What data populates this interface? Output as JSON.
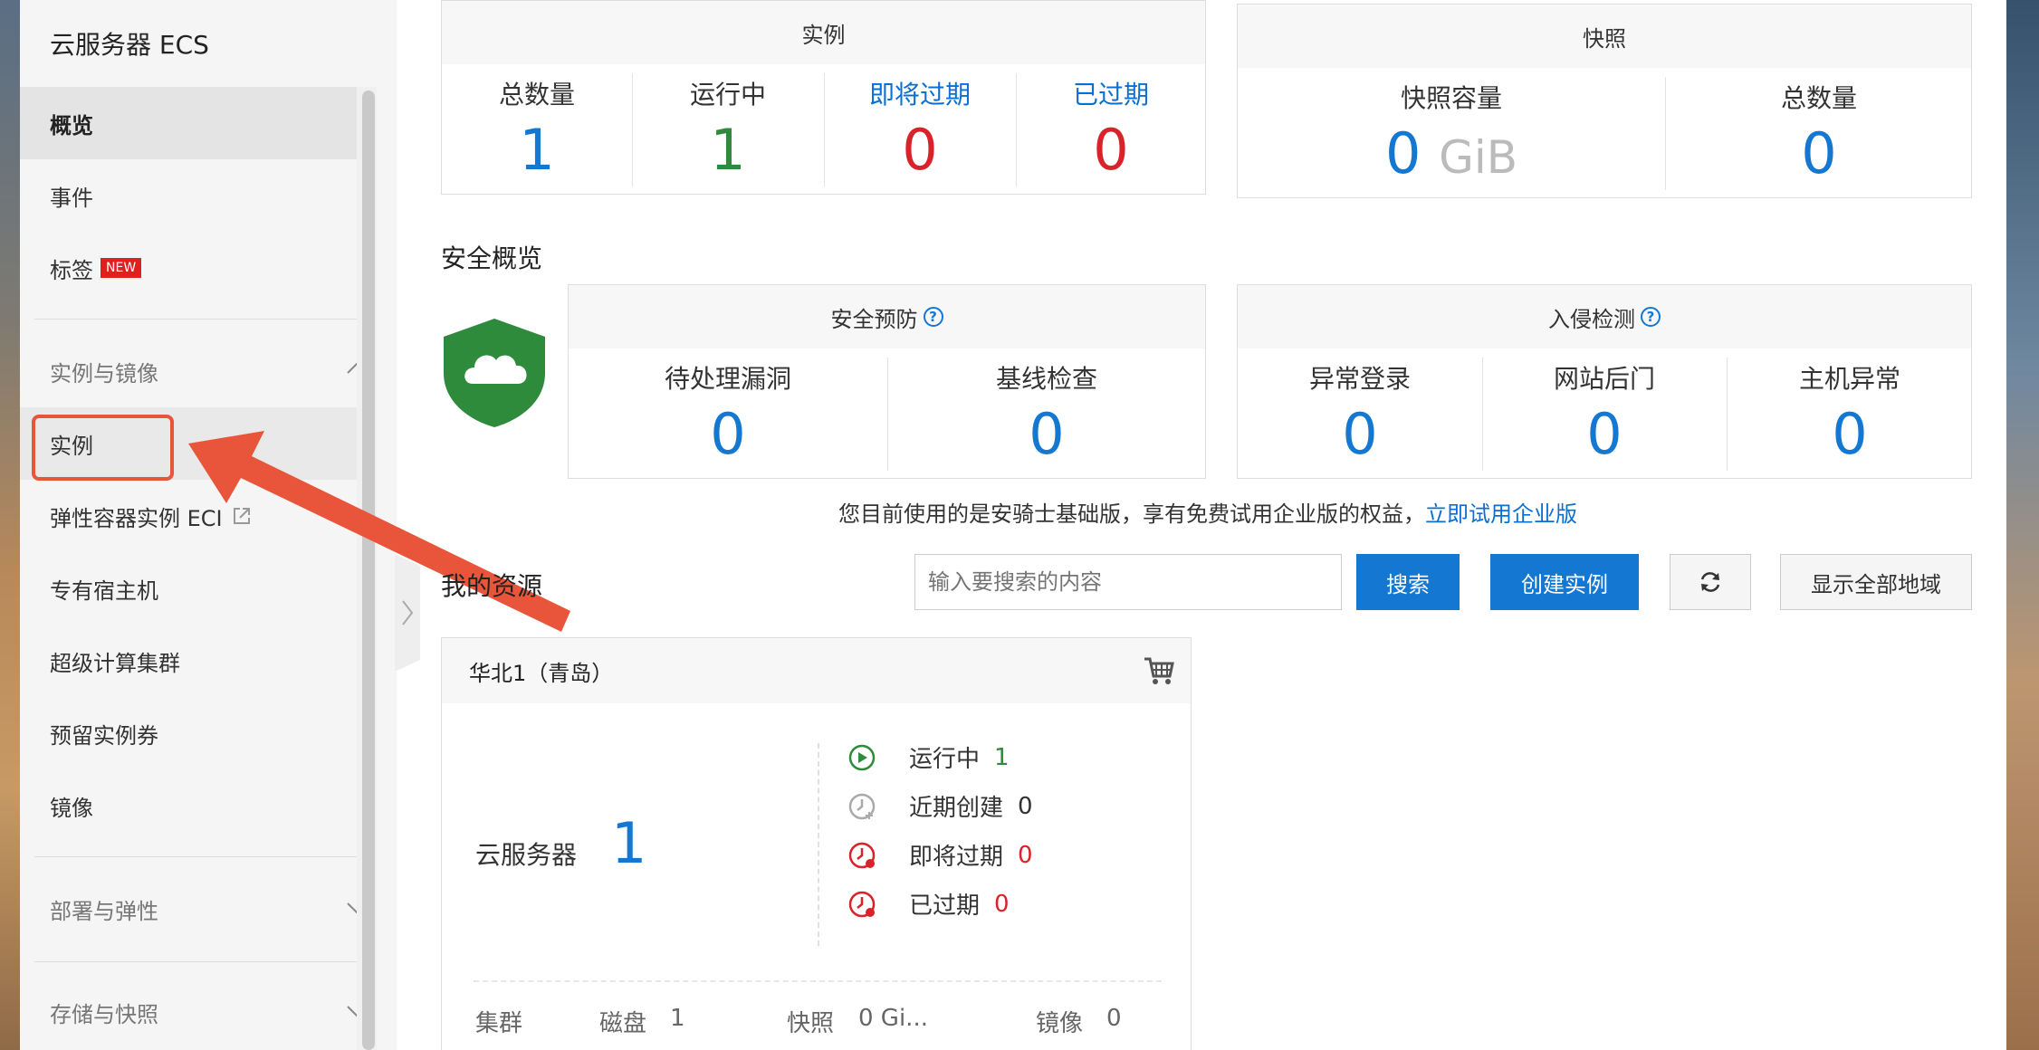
{
  "sidebar": {
    "title": "云服务器 ECS",
    "items": {
      "overview": "概览",
      "events": "事件",
      "tags": "标签",
      "tags_badge": "NEW",
      "instances": "实例",
      "eci": "弹性容器实例 ECI",
      "ddh": "专有宿主机",
      "scc": "超级计算集群",
      "reserved": "预留实例券",
      "images": "镜像"
    },
    "sections": {
      "instances_images": "实例与镜像",
      "deploy_elastic": "部署与弹性",
      "storage_snapshot": "存储与快照"
    }
  },
  "instances_card": {
    "title": "实例",
    "stats": [
      {
        "label": "总数量",
        "value": "1"
      },
      {
        "label": "运行中",
        "value": "1"
      },
      {
        "label": "即将过期",
        "value": "0"
      },
      {
        "label": "已过期",
        "value": "0"
      }
    ]
  },
  "snapshot_card": {
    "title": "快照",
    "capacity_label": "快照容量",
    "capacity_value": "0",
    "capacity_unit": "GiB",
    "total_label": "总数量",
    "total_value": "0"
  },
  "security": {
    "title": "安全概览",
    "prevention": {
      "title": "安全预防",
      "stats": [
        {
          "label": "待处理漏洞",
          "value": "0"
        },
        {
          "label": "基线检查",
          "value": "0"
        }
      ]
    },
    "intrusion": {
      "title": "入侵检测",
      "stats": [
        {
          "label": "异常登录",
          "value": "0"
        },
        {
          "label": "网站后门",
          "value": "0"
        },
        {
          "label": "主机异常",
          "value": "0"
        }
      ]
    },
    "notice_text": "您目前使用的是安骑士基础版，享有免费试用企业版的权益，",
    "notice_link": "立即试用企业版",
    "help": "?"
  },
  "resources": {
    "title": "我的资源",
    "search_placeholder": "输入要搜索的内容",
    "search_button": "搜索",
    "create_button": "创建实例",
    "show_all_regions": "显示全部地域",
    "region": {
      "name": "华北1（青岛）",
      "server_label": "云服务器",
      "server_count": "1",
      "statuses": [
        {
          "label": "运行中",
          "value": "1"
        },
        {
          "label": "近期创建",
          "value": "0"
        },
        {
          "label": "即将过期",
          "value": "0"
        },
        {
          "label": "已过期",
          "value": "0"
        }
      ],
      "bottom": {
        "cluster_label": "集群",
        "disk_label": "磁盘",
        "disk_value": "1",
        "snapshot_label": "快照",
        "snapshot_value": "0 Gi...",
        "image_label": "镜像",
        "image_value": "0"
      }
    }
  },
  "colors": {
    "primary": "#1478d2",
    "green": "#2e8b3c",
    "red": "#d9222a",
    "highlight": "#e8553a"
  }
}
